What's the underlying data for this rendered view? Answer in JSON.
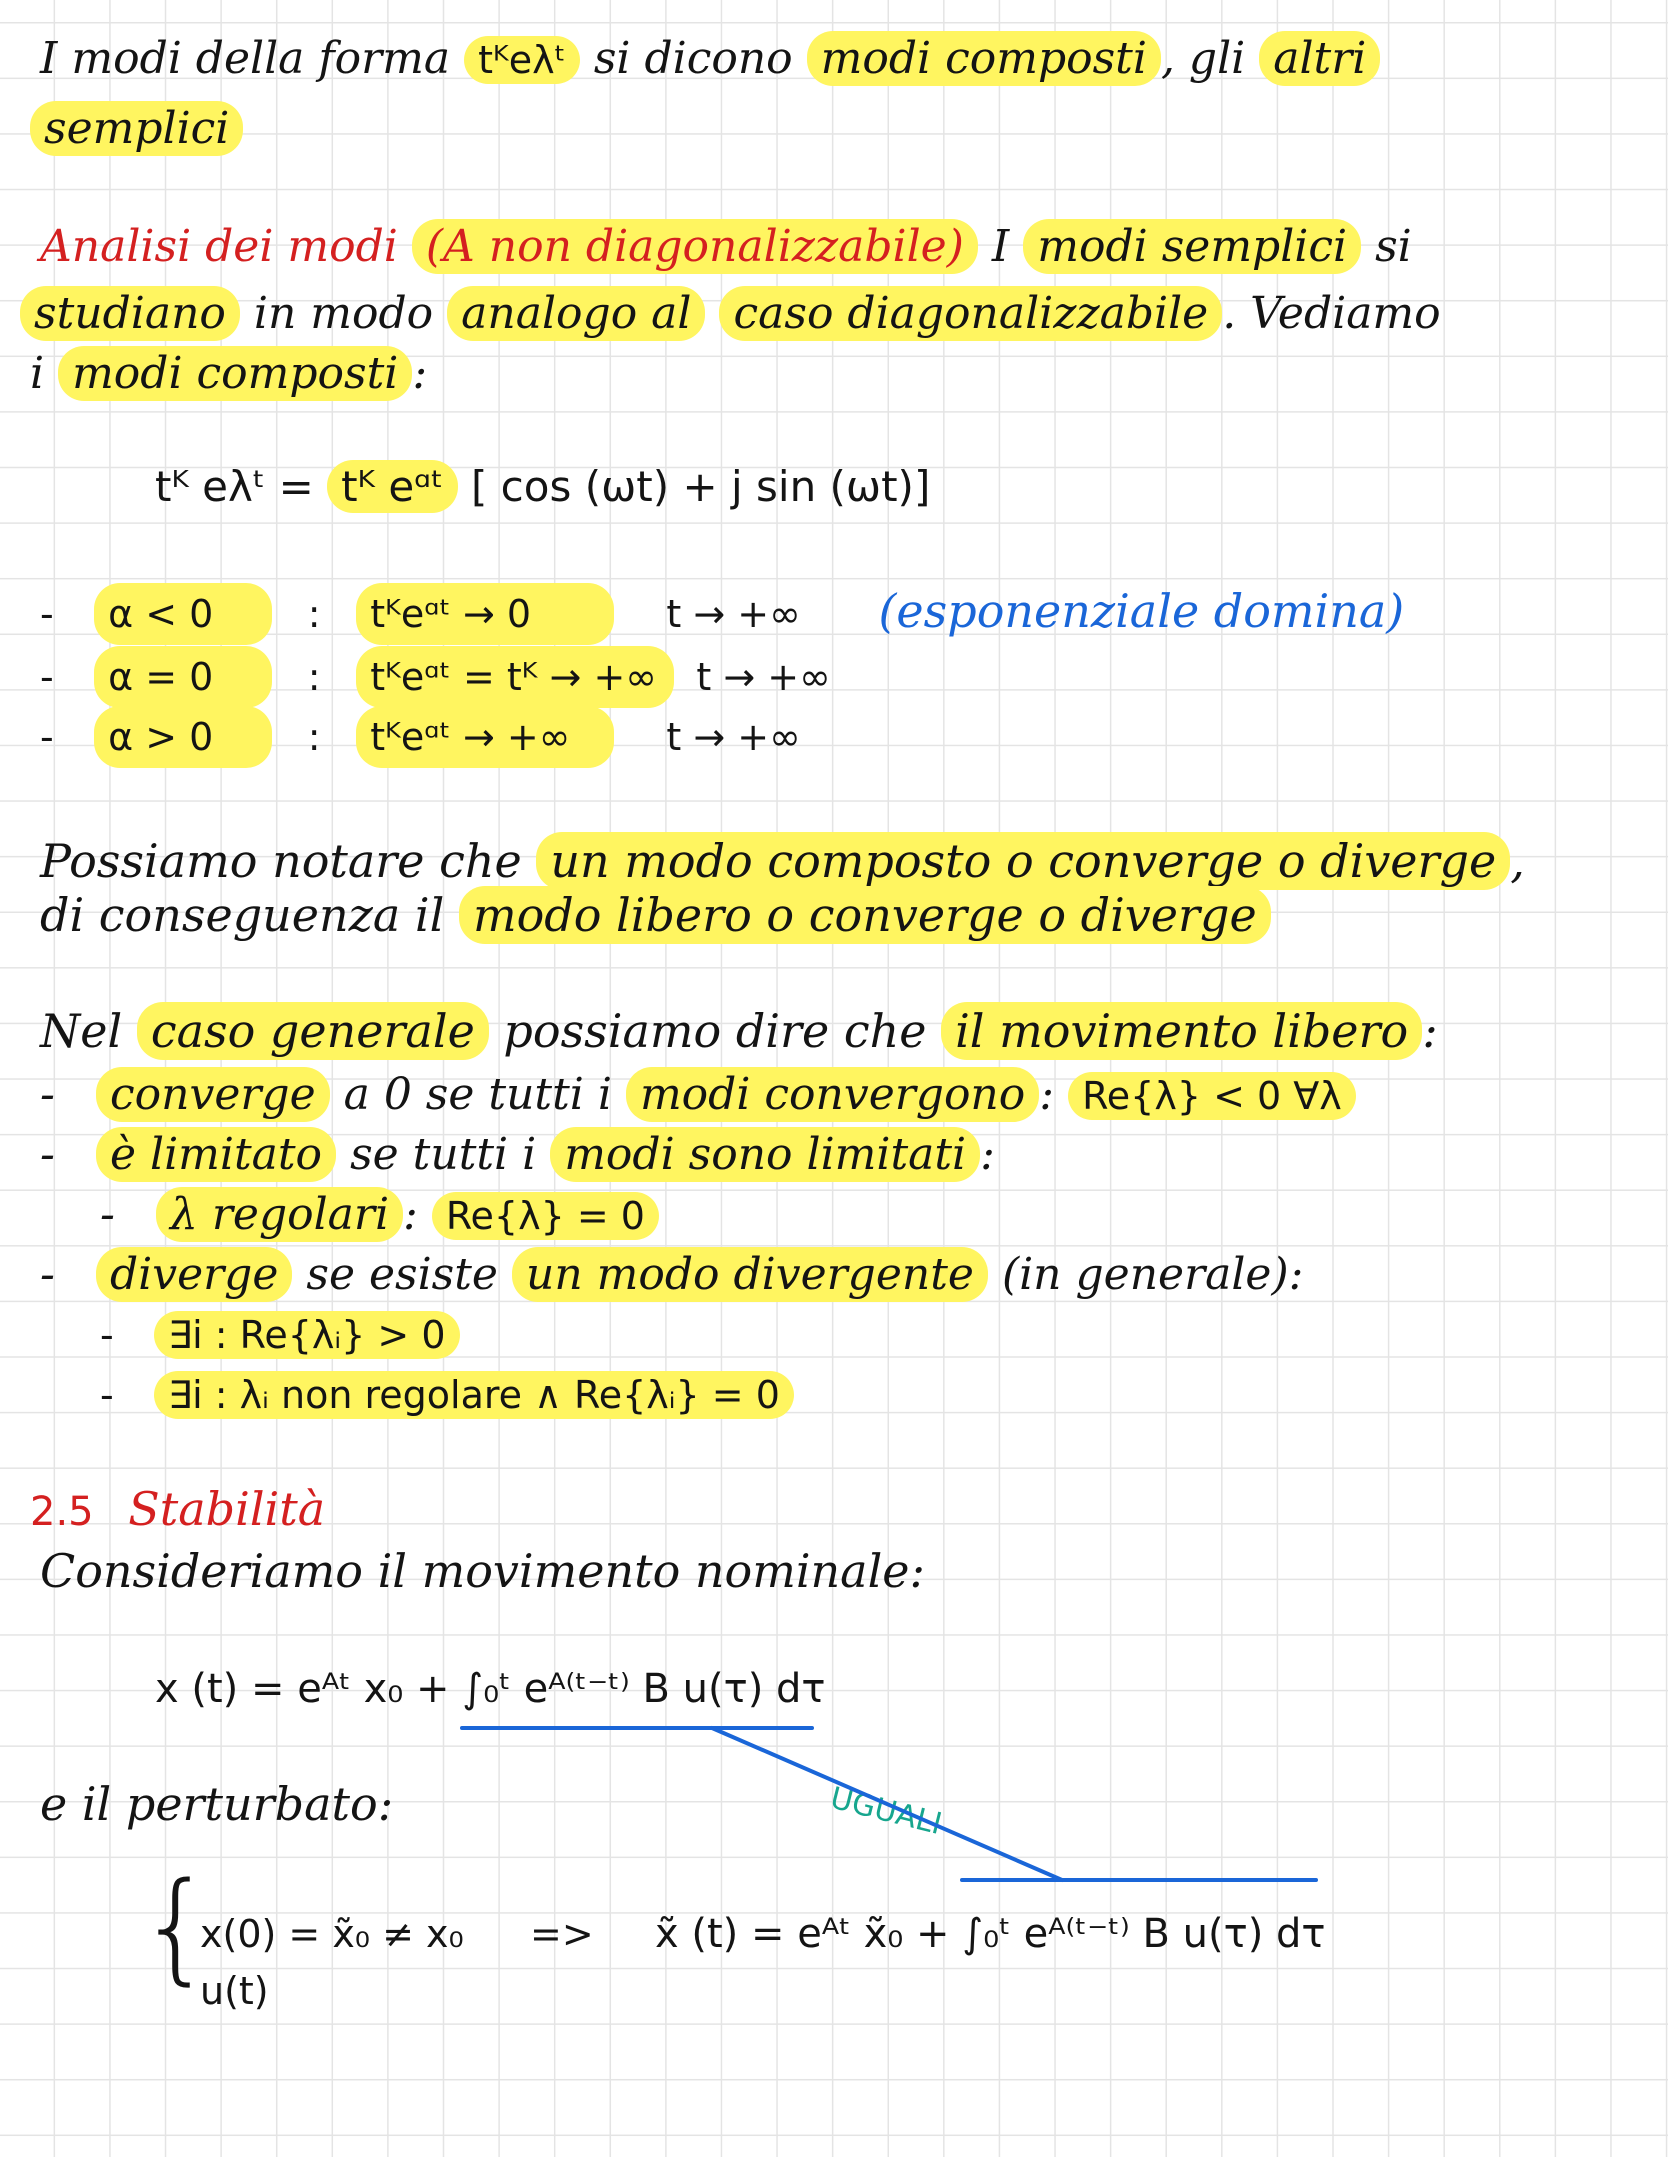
{
  "p1": {
    "before": "I modi della forma",
    "formula": "tᴷeλᵗ",
    "mid": "si dicono",
    "composti": "modi composti",
    "comma": ", gli",
    "altri": "altri",
    "semplici": "semplici"
  },
  "p2": {
    "title": "Analisi dei modi",
    "paren": "(A non diagonalizzabile)",
    "after_title": "I",
    "modi_semplici": "modi semplici",
    "si": "si",
    "studiano": "studiano",
    "in_modo": "in modo",
    "analogo": "analogo al",
    "caso": "caso diagonalizzabile",
    "vediamo": ". Vediamo",
    "i": "i",
    "modi_composti": "modi composti",
    "colon": ":"
  },
  "eq1": {
    "lhs": "tᴷ eλᵗ =",
    "hl": "tᴷ eᵅᵗ",
    "rhs": "[ cos (ωt) + j sin (ωt)]"
  },
  "cases": [
    {
      "cond": "α < 0",
      "sep": ":",
      "expr": "tᴷeᵅᵗ → 0",
      "limit": "t → +∞",
      "note": "(esponenziale domina)"
    },
    {
      "cond": "α = 0",
      "sep": ":",
      "expr": "tᴷeᵅᵗ = tᴷ → +∞",
      "limit": "t → +∞",
      "note": ""
    },
    {
      "cond": "α > 0",
      "sep": ":",
      "expr": "tᴷeᵅᵗ → +∞",
      "limit": "t → +∞",
      "note": ""
    }
  ],
  "p3": {
    "line1_a": "Possiamo notare che",
    "line1_hl": "un modo composto o converge o diverge",
    "line1_b": ",",
    "line2_a": "di conseguenza il",
    "line2_hl": "modo libero o converge o diverge"
  },
  "p4": {
    "intro_a": "Nel",
    "intro_hl1": "caso generale",
    "intro_b": "possiamo dire che",
    "intro_hl2": "il movimento libero",
    "intro_c": ":",
    "b1_hl": "converge",
    "b1_a": "a 0 se tutti i",
    "b1_hl2": "modi convergono",
    "b1_b": ":",
    "b1_hl3": "Re{λ} < 0   ∀λ",
    "b2_hl": "è limitato",
    "b2_a": "se tutti i",
    "b2_hl2": "modi sono limitati",
    "b2_b": ":",
    "b2_sub_hl": "λ regolari",
    "b2_sub_a": ":",
    "b2_sub_hl2": "Re{λ} = 0",
    "b3_hl": "diverge",
    "b3_a": "se esiste",
    "b3_hl2": "un modo divergente",
    "b3_b": "(in generale):",
    "b3_sub1": "∃i  :  Re{λᵢ} > 0",
    "b3_sub2": "∃i  :   λᵢ non regolare  ∧  Re{λᵢ} = 0"
  },
  "section": {
    "number": "2.5",
    "title": "Stabilità"
  },
  "p5": {
    "intro": "Consideriamo il movimento nominale:",
    "eq_nominal": "x (t) = eᴬᵗ x₀ + ∫₀ᵗ eᴬ⁽ᵗ⁻ᵗ⁾ B u(τ) dτ",
    "perturbato": "e il perturbato:",
    "sys1": "x(0) = x̃₀ ≠ x₀",
    "sys2": "u(t)",
    "arrow": "=>",
    "eq_perturbed": "x̃ (t) = eᴬᵗ x̃₀ + ∫₀ᵗ eᴬ⁽ᵗ⁻ᵗ⁾ B u(τ) dτ",
    "uguali": "UGUALI"
  },
  "colors": {
    "highlight": "#fff560",
    "title_red": "#d42020",
    "note_blue": "#1a66d8",
    "connector_blue": "#1a66d8",
    "uguali_teal": "#17a68e",
    "grid": "#e4e4e4"
  }
}
